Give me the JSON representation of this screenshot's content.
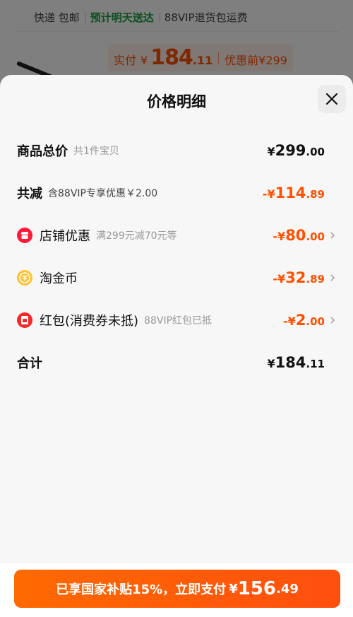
{
  "background": {
    "title": "",
    "tags": [
      "快递 包邮",
      "预计明天送达",
      "88VIP退货包运费"
    ],
    "price_label": "实付",
    "currency": "¥",
    "price_int": "184",
    "price_dec": ".11",
    "original_price": "优惠前¥299"
  },
  "sheet": {
    "title": "价格明细",
    "rows": [
      {
        "label": "商品总价",
        "sub": "共1件宝贝",
        "sym": "¥",
        "int": "299",
        "dec": ".00",
        "color": "black"
      },
      {
        "label": "共减",
        "sub": "含88VIP专享优惠￥2.00",
        "sym": "-¥",
        "int": "114",
        "dec": ".89",
        "color": "orange"
      },
      {
        "label": "店铺优惠",
        "sub": "满299元减70元等",
        "sym": "-¥",
        "int": "80",
        "dec": ".00",
        "color": "orange"
      },
      {
        "label": "淘金币",
        "sub": "",
        "sym": "-¥",
        "int": "32",
        "dec": ".89",
        "color": "orange"
      },
      {
        "label": "红包(消费券未抵)",
        "sub": "88VIP红包已抵",
        "sym": "-¥",
        "int": "2",
        "dec": ".00",
        "color": "orange"
      },
      {
        "label": "合计",
        "sub": "",
        "sym": "¥",
        "int": "184",
        "dec": ".11",
        "color": "black"
      }
    ]
  },
  "pay_button": {
    "text": "已享国家补贴15%，立即支付",
    "sym": "¥",
    "int": "156",
    "dec": ".49"
  },
  "colors": {
    "accent": "#ff5000",
    "store_icon": "#ff1a3c",
    "coin_icon": "#ffc233",
    "redpack_icon": "#f42a2a"
  }
}
